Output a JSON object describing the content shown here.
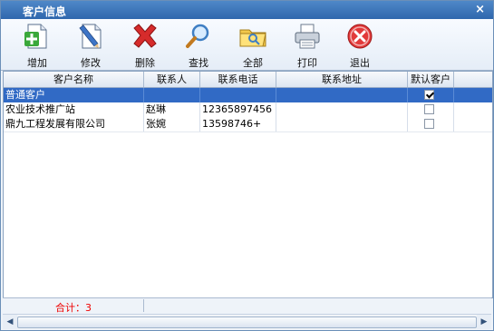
{
  "window": {
    "title": "客户信息",
    "close_label": "×"
  },
  "toolbar": {
    "add_label": "增加",
    "edit_label": "修改",
    "delete_label": "删除",
    "search_label": "查找",
    "all_label": "全部",
    "print_label": "打印",
    "exit_label": "退出"
  },
  "table": {
    "headers": [
      "客户名称",
      "联系人",
      "联系电话",
      "联系地址",
      "默认客户"
    ],
    "rows": [
      {
        "name": "普通客户",
        "contact": "",
        "phone": "",
        "address": "",
        "default": true,
        "selected": true
      },
      {
        "name": "农业技术推广站",
        "contact": "赵琳",
        "phone": "12365897456",
        "address": "",
        "default": false,
        "selected": false
      },
      {
        "name": "鼎九工程发展有限公司",
        "contact": "张婉",
        "phone": "13598746+",
        "address": "",
        "default": false,
        "selected": false
      }
    ]
  },
  "footer": {
    "total_text": "合计：3"
  },
  "colors": {
    "selected_row": "#316ac5",
    "total_text": "#e00000",
    "title_bar": "#3a74b9"
  }
}
